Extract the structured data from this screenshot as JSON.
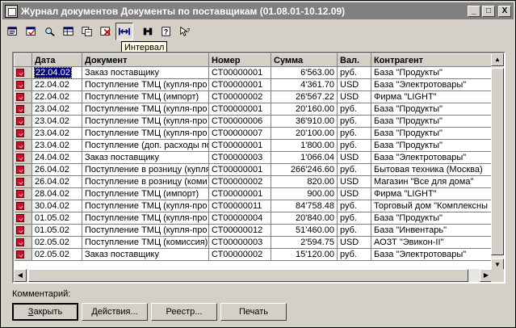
{
  "window": {
    "title": "Журнал документов  Документы по поставщикам (01.08.01-10.12.09)",
    "controls": [
      "_",
      "□",
      "X"
    ]
  },
  "toolbar": {
    "tooltip": "Интервал",
    "icons": [
      "new-document-icon",
      "copy-document-icon",
      "find-icon",
      "table-icon",
      "transfer-icon",
      "delete-mark-icon",
      "interval-icon",
      "binoculars-icon",
      "help-icon",
      "whats-this-icon"
    ]
  },
  "table": {
    "columns": [
      "",
      "Дата",
      "Документ",
      "Номер",
      "Сумма",
      "Вал.",
      "Контрагент"
    ],
    "rows": [
      [
        "22.04.02",
        "Заказ поставщику",
        "СТ00000001",
        "6'563.00",
        "руб.",
        "База \"Продукты\""
      ],
      [
        "22.04.02",
        "Поступление ТМЦ (купля-про",
        "СТ00000001",
        "4'361.70",
        "USD",
        "База \"Электротовары\""
      ],
      [
        "22.04.02",
        "Поступление ТМЦ (импорт)",
        "СТ00000002",
        "26'567.22",
        "USD",
        "Фирма \"LIGHT\""
      ],
      [
        "23.04.02",
        "Поступление ТМЦ (купля-про",
        "СТ00000001",
        "20'160.00",
        "руб.",
        "База \"Продукты\""
      ],
      [
        "23.04.02",
        "Поступление ТМЦ (купля-про",
        "СТ00000006",
        "36'910.00",
        "руб.",
        "База \"Продукты\""
      ],
      [
        "23.04.02",
        "Поступление ТМЦ (купля-про",
        "СТ00000007",
        "20'100.00",
        "руб.",
        "База \"Продукты\""
      ],
      [
        "23.04.02",
        "Поступление (доп. расходы по",
        "СТ00000001",
        "1'800.00",
        "руб.",
        "База \"Продукты\""
      ],
      [
        "24.04.02",
        "Заказ поставщику",
        "СТ00000003",
        "1'066.04",
        "USD",
        "База \"Электротовары\""
      ],
      [
        "26.04.02",
        "Поступление в розницу (купля",
        "СТ00000001",
        "266'246.60",
        "руб.",
        "Бытовая техника (Москва)"
      ],
      [
        "26.04.02",
        "Поступление в розницу (коми",
        "СТ00000002",
        "820.00",
        "USD",
        "Магазин \"Все для дома\""
      ],
      [
        "28.04.02",
        "Поступление ТМЦ (импорт)",
        "СТ00000001",
        "900.00",
        "USD",
        "Фирма \"LIGHT\""
      ],
      [
        "30.04.02",
        "Поступление ТМЦ (купля-про",
        "СТ00000011",
        "84'758.48",
        "руб.",
        "Торговый дом \"Комплексны"
      ],
      [
        "01.05.02",
        "Поступление ТМЦ (купля-про",
        "СТ00000004",
        "20'840.00",
        "руб.",
        "База \"Продукты\""
      ],
      [
        "01.05.02",
        "Поступление ТМЦ (купля-про",
        "СТ00000012",
        "51'460.00",
        "руб.",
        "База \"Инвентарь\""
      ],
      [
        "02.05.02",
        "Поступление ТМЦ (комиссия)",
        "СТ00000003",
        "2'594.75",
        "USD",
        "АОЗТ \"Эвикон-II\""
      ],
      [
        "02.05.02",
        "Заказ поставщику",
        "СТ00000002",
        "15'120.00",
        "руб.",
        "База \"Электротовары\""
      ]
    ]
  },
  "footer": {
    "comment_label": "Комментарий:",
    "buttons": [
      {
        "label": "Закрыть",
        "underline": "З",
        "rest": "акрыть"
      },
      {
        "label": "Действия...",
        "underline": "",
        "rest": "Действия..."
      },
      {
        "label": "Реестр...",
        "underline": "",
        "rest": "Реестр..."
      },
      {
        "label": "Печать",
        "underline": "",
        "rest": "Печать"
      }
    ]
  },
  "colors": {
    "title_bar": "#808080",
    "selection": "#000080",
    "window": "#d4d0c8"
  }
}
